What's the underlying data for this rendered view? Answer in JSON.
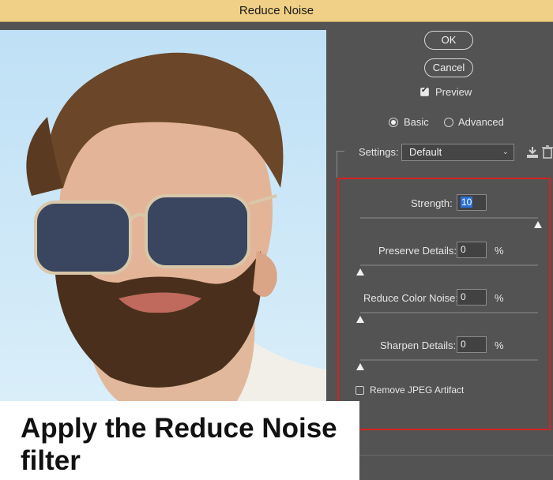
{
  "window": {
    "title": "Reduce Noise"
  },
  "buttons": {
    "ok": "OK",
    "cancel": "Cancel"
  },
  "preview_check": {
    "label": "Preview",
    "checked": true
  },
  "mode": {
    "basic": "Basic",
    "advanced": "Advanced",
    "selected": "Basic"
  },
  "settings": {
    "label": "Settings:",
    "value": "Default"
  },
  "controls": {
    "strength": {
      "label": "Strength:",
      "value": "10"
    },
    "preserve": {
      "label": "Preserve Details:",
      "value": "0",
      "unit": "%"
    },
    "color_noise": {
      "label": "Reduce Color Noise:",
      "value": "0",
      "unit": "%"
    },
    "sharpen": {
      "label": "Sharpen Details:",
      "value": "0",
      "unit": "%"
    },
    "jpeg": {
      "label": "Remove JPEG Artifact",
      "checked": false
    }
  },
  "slider_levels": {
    "strength": 1.0,
    "preserve": 0.0,
    "color_noise": 0.0,
    "sharpen": 0.0
  },
  "caption": {
    "text": "Apply the Reduce Noise filter"
  },
  "colors": {
    "title_bar": "#f0cf86",
    "panel": "#535353",
    "highlight": "#d42222"
  }
}
